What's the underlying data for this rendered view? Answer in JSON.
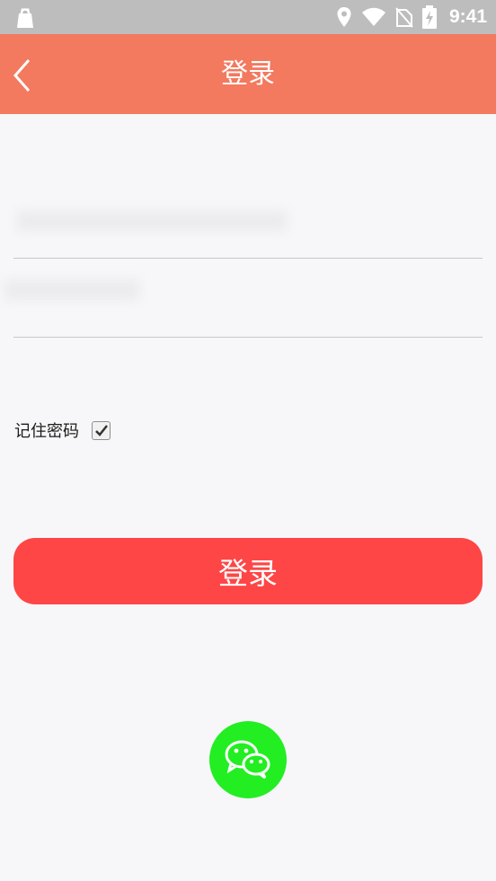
{
  "status_bar": {
    "time": "9:41",
    "icons": [
      "shop-bag-icon",
      "location-icon",
      "wifi-icon",
      "sim-off-icon",
      "battery-charging-icon"
    ]
  },
  "header": {
    "title": "登录",
    "back_icon": "chevron-left-icon"
  },
  "form": {
    "username": {
      "value": "",
      "placeholder": ""
    },
    "password": {
      "value": "",
      "placeholder": ""
    },
    "remember_label": "记住密码",
    "remember_checked": true,
    "login_label": "登录"
  },
  "social": {
    "wechat_icon": "wechat-icon"
  },
  "colors": {
    "header_bg": "#f3795f",
    "login_button": "#fe4646",
    "wechat": "#22ee22",
    "page_bg": "#f7f7f9",
    "status_bar": "#bdbdbd"
  }
}
